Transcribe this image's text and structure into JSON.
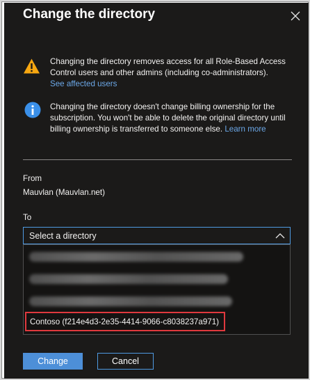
{
  "dialog": {
    "title": "Change the directory"
  },
  "warning": {
    "icon": "warning-icon",
    "text": "Changing the directory removes access for all Role-Based Access Control users and other admins (including co-administrators).",
    "link": "See affected users"
  },
  "info": {
    "icon": "info-icon",
    "text": "Changing the directory doesn't change billing ownership for the subscription. You won't be able to delete the original directory until billing ownership is transferred to someone else.",
    "link": "Learn more"
  },
  "from": {
    "label": "From",
    "value": "Mauvlan (Mauvlan.net)"
  },
  "to": {
    "label": "To",
    "placeholder": "Select a directory",
    "options": [
      "Contoso (f214e4d3-2e35-4414-9066-c8038237a971)"
    ]
  },
  "buttons": {
    "change": "Change",
    "cancel": "Cancel"
  },
  "colors": {
    "background": "#1b1a19",
    "accent": "#4d8fd8",
    "link": "#6ca8e8",
    "warning": "#f7a711",
    "info": "#3a8fe8",
    "highlight": "#e0393e"
  }
}
